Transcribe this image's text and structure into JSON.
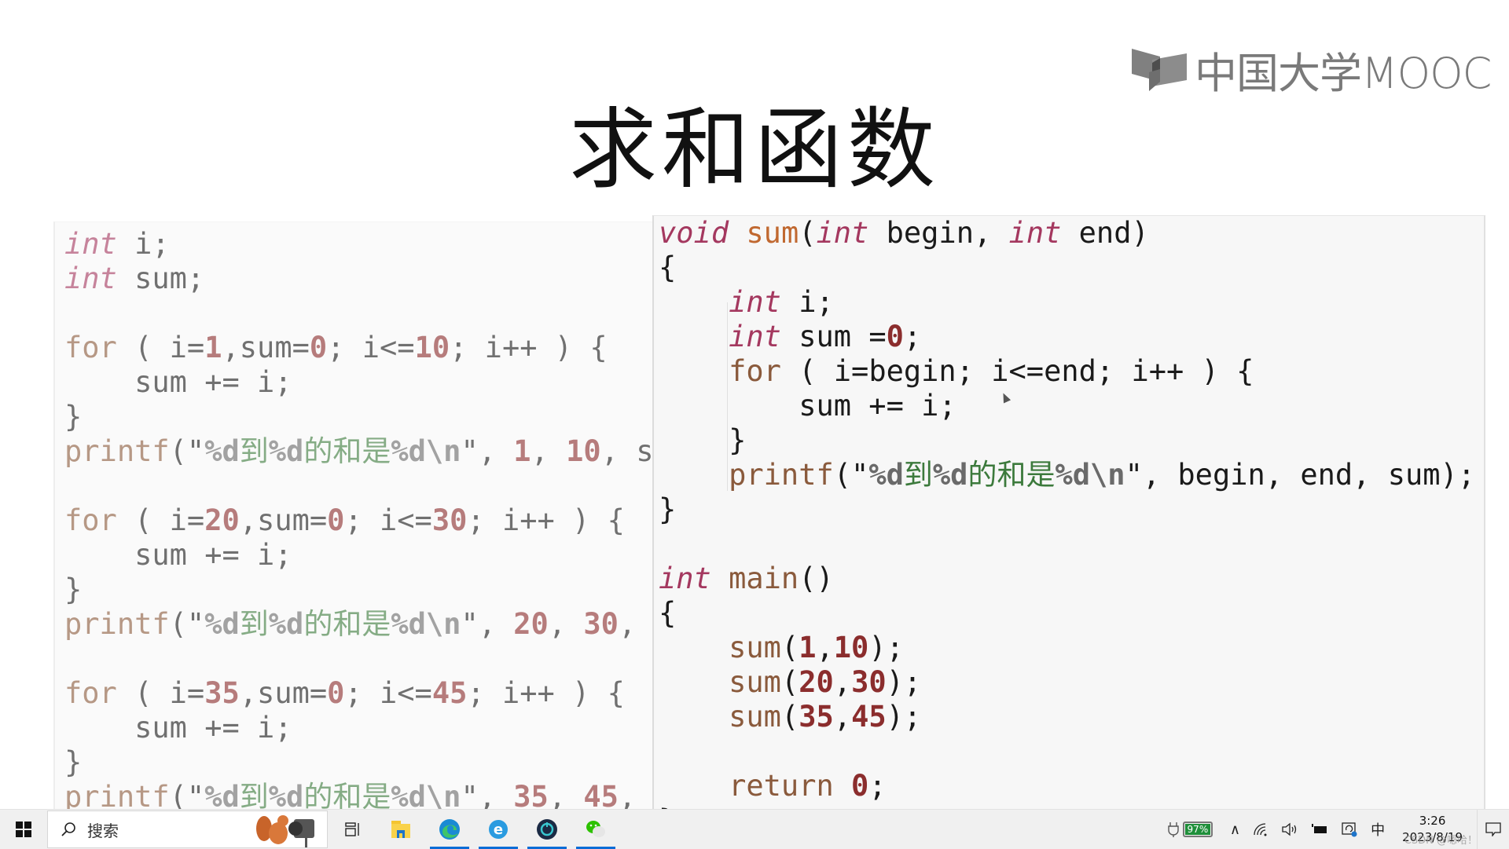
{
  "slide": {
    "title": "求和函数",
    "logo_text": "中国大学MOOC",
    "left_code": [
      [
        [
          "kw",
          "int"
        ],
        [
          "plain",
          " i;"
        ]
      ],
      [
        [
          "kw",
          "int"
        ],
        [
          "plain",
          " sum;"
        ]
      ],
      [],
      [
        [
          "ctl",
          "for"
        ],
        [
          "plain",
          " ( i="
        ],
        [
          "num",
          "1"
        ],
        [
          "plain",
          ",sum="
        ],
        [
          "num",
          "0"
        ],
        [
          "plain",
          "; i<="
        ],
        [
          "num",
          "10"
        ],
        [
          "plain",
          "; i++ ) {"
        ]
      ],
      [
        [
          "plain",
          "    sum += i;"
        ]
      ],
      [
        [
          "plain",
          "}"
        ]
      ],
      [
        [
          "ctl",
          "printf"
        ],
        [
          "plain",
          "(\""
        ],
        [
          "fmt",
          "%d"
        ],
        [
          "str",
          "到"
        ],
        [
          "fmt",
          "%d"
        ],
        [
          "str",
          "的和是"
        ],
        [
          "fmt",
          "%d\\n"
        ],
        [
          "plain",
          "\", "
        ],
        [
          "num",
          "1"
        ],
        [
          "plain",
          ", "
        ],
        [
          "num",
          "10"
        ],
        [
          "plain",
          ", sum);"
        ]
      ],
      [],
      [
        [
          "ctl",
          "for"
        ],
        [
          "plain",
          " ( i="
        ],
        [
          "num",
          "20"
        ],
        [
          "plain",
          ",sum="
        ],
        [
          "num",
          "0"
        ],
        [
          "plain",
          "; i<="
        ],
        [
          "num",
          "30"
        ],
        [
          "plain",
          "; i++ ) {"
        ]
      ],
      [
        [
          "plain",
          "    sum += i;"
        ]
      ],
      [
        [
          "plain",
          "}"
        ]
      ],
      [
        [
          "ctl",
          "printf"
        ],
        [
          "plain",
          "(\""
        ],
        [
          "fmt",
          "%d"
        ],
        [
          "str",
          "到"
        ],
        [
          "fmt",
          "%d"
        ],
        [
          "str",
          "的和是"
        ],
        [
          "fmt",
          "%d\\n"
        ],
        [
          "plain",
          "\", "
        ],
        [
          "num",
          "20"
        ],
        [
          "plain",
          ", "
        ],
        [
          "num",
          "30"
        ],
        [
          "plain",
          ", sum);"
        ]
      ],
      [],
      [
        [
          "ctl",
          "for"
        ],
        [
          "plain",
          " ( i="
        ],
        [
          "num",
          "35"
        ],
        [
          "plain",
          ",sum="
        ],
        [
          "num",
          "0"
        ],
        [
          "plain",
          "; i<="
        ],
        [
          "num",
          "45"
        ],
        [
          "plain",
          "; i++ ) {"
        ]
      ],
      [
        [
          "plain",
          "    sum += i;"
        ]
      ],
      [
        [
          "plain",
          "}"
        ]
      ],
      [
        [
          "ctl",
          "printf"
        ],
        [
          "plain",
          "(\""
        ],
        [
          "fmt",
          "%d"
        ],
        [
          "str",
          "到"
        ],
        [
          "fmt",
          "%d"
        ],
        [
          "str",
          "的和是"
        ],
        [
          "fmt",
          "%d\\n"
        ],
        [
          "plain",
          "\", "
        ],
        [
          "num",
          "35"
        ],
        [
          "plain",
          ", "
        ],
        [
          "num",
          "45"
        ],
        [
          "plain",
          ", sum);"
        ]
      ]
    ],
    "right_code": [
      [
        [
          "kw",
          "void"
        ],
        [
          "plain",
          " "
        ],
        [
          "fn",
          "sum"
        ],
        [
          "plain",
          "("
        ],
        [
          "kw",
          "int"
        ],
        [
          "plain",
          " begin, "
        ],
        [
          "kw",
          "int"
        ],
        [
          "plain",
          " end)"
        ]
      ],
      [
        [
          "plain",
          "{"
        ]
      ],
      [
        [
          "plain",
          "    "
        ],
        [
          "kw",
          "int"
        ],
        [
          "plain",
          " i;"
        ]
      ],
      [
        [
          "plain",
          "    "
        ],
        [
          "kw",
          "int"
        ],
        [
          "plain",
          " sum ="
        ],
        [
          "num",
          "0"
        ],
        [
          "plain",
          ";"
        ]
      ],
      [
        [
          "plain",
          "    "
        ],
        [
          "ctl",
          "for"
        ],
        [
          "plain",
          " ( i=begin; i<=end; i++ ) {"
        ]
      ],
      [
        [
          "plain",
          "        sum += i;"
        ]
      ],
      [
        [
          "plain",
          "    }"
        ]
      ],
      [
        [
          "plain",
          "    "
        ],
        [
          "ctl",
          "printf"
        ],
        [
          "plain",
          "(\""
        ],
        [
          "fmt",
          "%d"
        ],
        [
          "str",
          "到"
        ],
        [
          "fmt",
          "%d"
        ],
        [
          "str",
          "的和是"
        ],
        [
          "fmt",
          "%d\\n"
        ],
        [
          "plain",
          "\", begin, end, sum);"
        ]
      ],
      [
        [
          "plain",
          "}"
        ]
      ],
      [],
      [
        [
          "kw",
          "int"
        ],
        [
          "plain",
          " "
        ],
        [
          "ctl",
          "main"
        ],
        [
          "plain",
          "()"
        ]
      ],
      [
        [
          "plain",
          "{"
        ]
      ],
      [
        [
          "plain",
          "    "
        ],
        [
          "ctl",
          "sum"
        ],
        [
          "plain",
          "("
        ],
        [
          "num",
          "1"
        ],
        [
          "plain",
          ","
        ],
        [
          "num",
          "10"
        ],
        [
          "plain",
          ");"
        ]
      ],
      [
        [
          "plain",
          "    "
        ],
        [
          "ctl",
          "sum"
        ],
        [
          "plain",
          "("
        ],
        [
          "num",
          "20"
        ],
        [
          "plain",
          ","
        ],
        [
          "num",
          "30"
        ],
        [
          "plain",
          ");"
        ]
      ],
      [
        [
          "plain",
          "    "
        ],
        [
          "ctl",
          "sum"
        ],
        [
          "plain",
          "("
        ],
        [
          "num",
          "35"
        ],
        [
          "plain",
          ","
        ],
        [
          "num",
          "45"
        ],
        [
          "plain",
          ");"
        ]
      ],
      [],
      [
        [
          "plain",
          "    "
        ],
        [
          "ctl",
          "return"
        ],
        [
          "plain",
          " "
        ],
        [
          "num",
          "0"
        ],
        [
          "plain",
          ";"
        ]
      ],
      [
        [
          "plain",
          "}"
        ]
      ]
    ]
  },
  "taskbar": {
    "search_label": "搜索",
    "apps": [
      {
        "name": "task-view",
        "active": false
      },
      {
        "name": "file-explorer",
        "active": false
      },
      {
        "name": "edge",
        "active": true
      },
      {
        "name": "ie-browser",
        "active": true
      },
      {
        "name": "app-circle",
        "active": true
      },
      {
        "name": "wechat",
        "active": true
      }
    ],
    "battery_percent": "97%",
    "ime": "中",
    "time": "3:26",
    "date": "2023/8/19",
    "watermark": "CSDN @嗯哈！"
  },
  "colors": {
    "keyword": "#a4385f",
    "number": "#8b2d2d",
    "string": "#3c7a3c",
    "battery": "#1f8f3a",
    "taskbar_accent": "#0a6cd6"
  }
}
